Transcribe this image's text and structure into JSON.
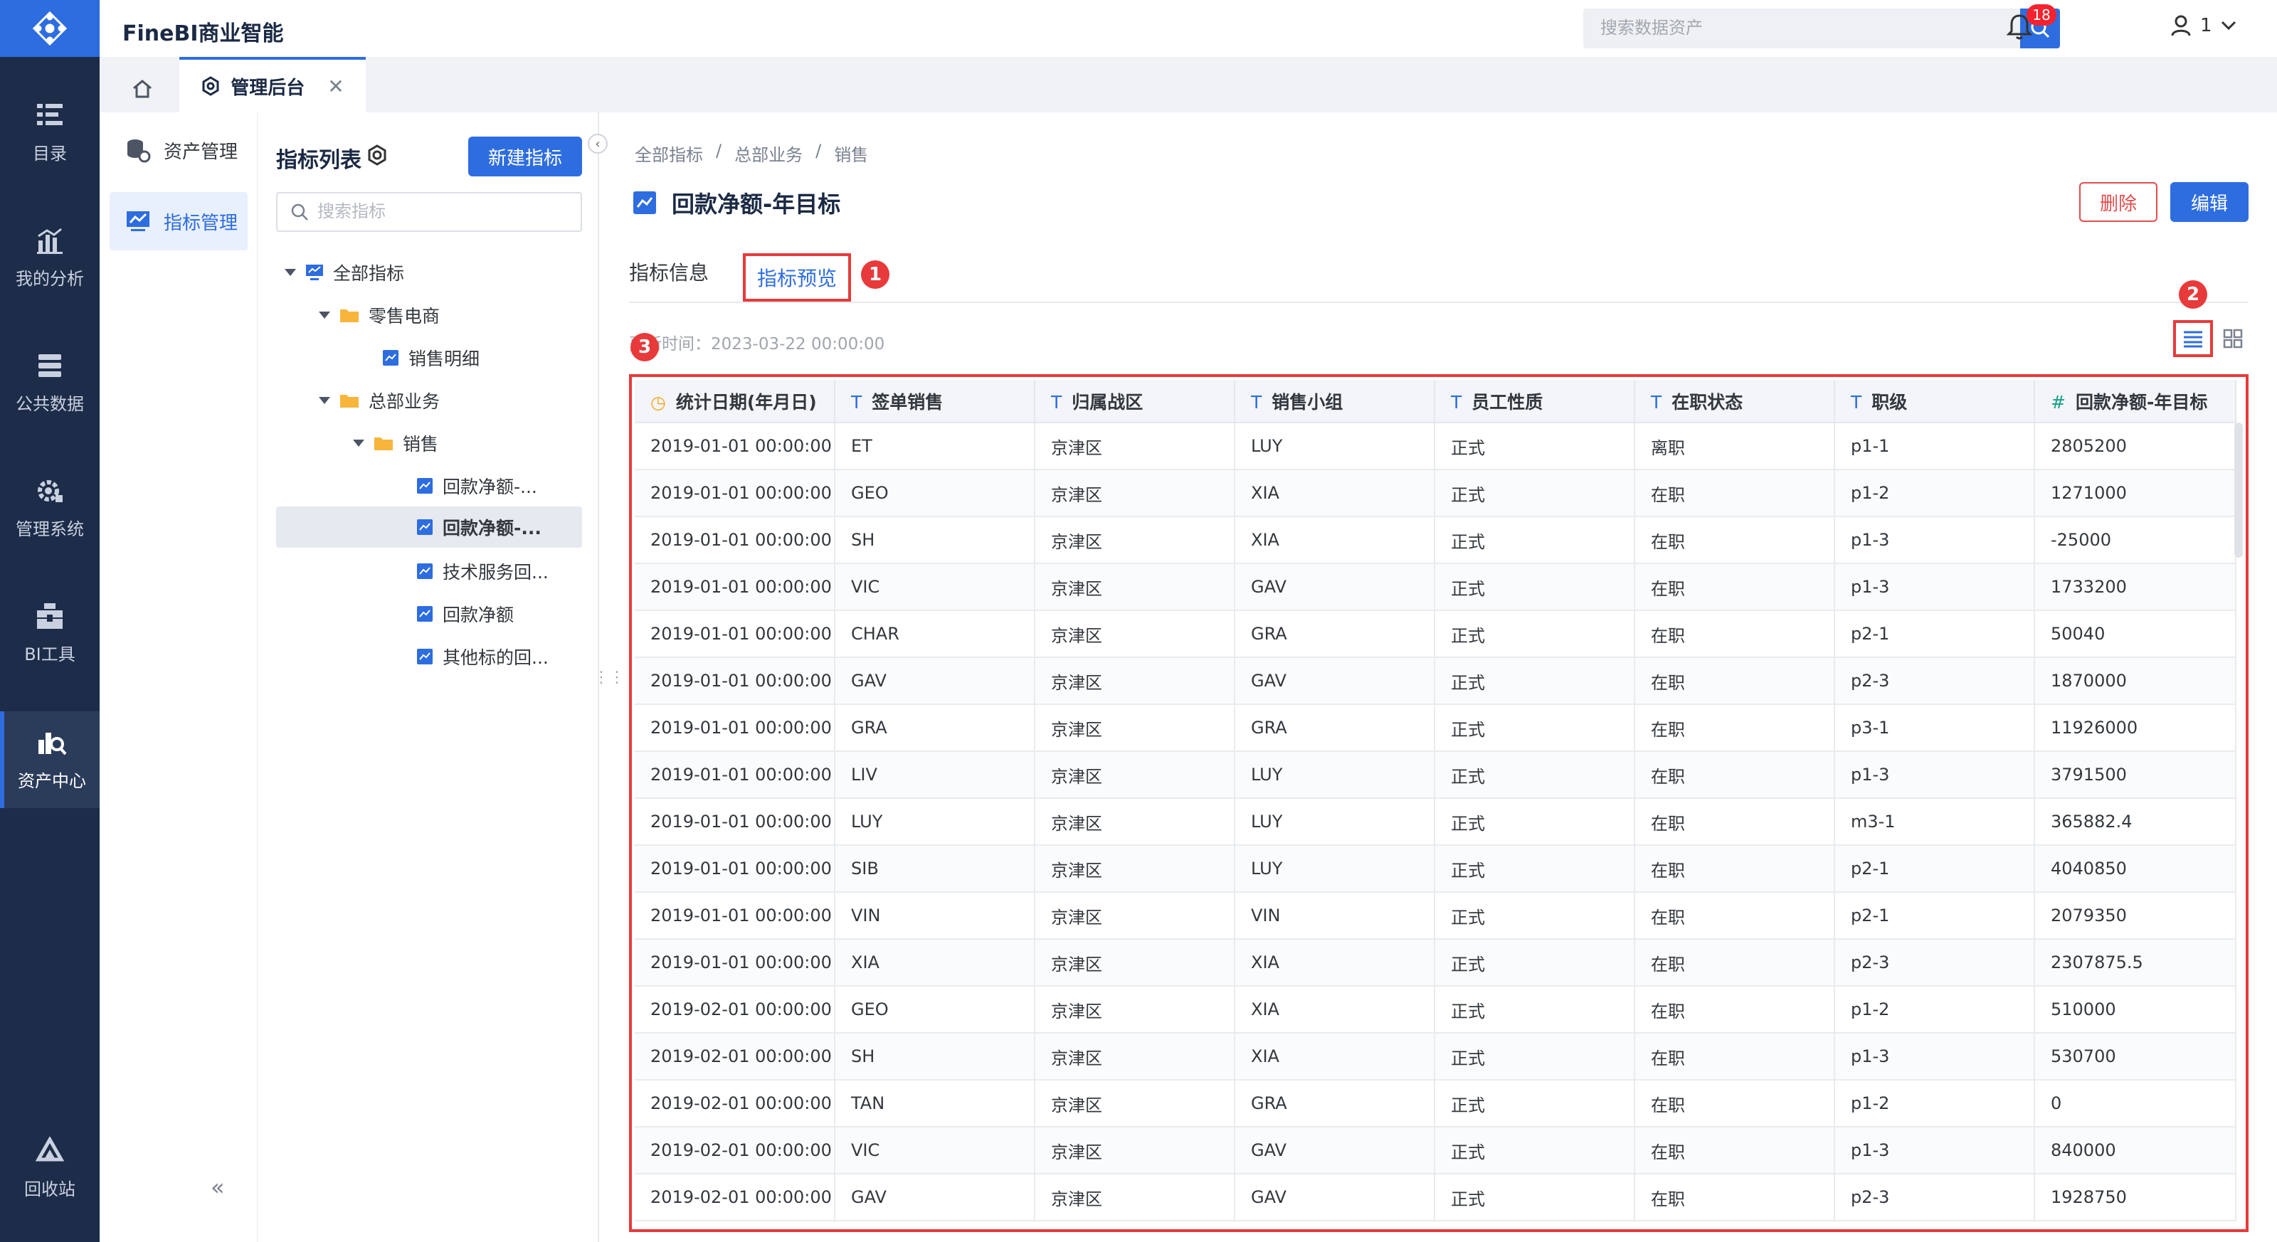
{
  "app": {
    "title": "FineBI商业智能"
  },
  "header": {
    "search_placeholder": "搜索数据资产",
    "notification_count": "18",
    "user_label": "1"
  },
  "nav": {
    "items": [
      {
        "label": "目录",
        "icon": "catalog-icon"
      },
      {
        "label": "我的分析",
        "icon": "analysis-icon"
      },
      {
        "label": "公共数据",
        "icon": "public-data-icon"
      },
      {
        "label": "管理系统",
        "icon": "management-icon"
      },
      {
        "label": "BI工具",
        "icon": "bi-tools-icon"
      },
      {
        "label": "资产中心",
        "icon": "asset-center-icon"
      },
      {
        "label": "回收站",
        "icon": "recycle-bin-icon"
      }
    ],
    "active": "资产中心"
  },
  "tabs": {
    "admin_label": "管理后台"
  },
  "sidebar": {
    "items": [
      {
        "label": "资产管理"
      },
      {
        "label": "指标管理"
      }
    ],
    "active": "指标管理"
  },
  "tree": {
    "title": "指标列表",
    "new_button": "新建指标",
    "search_placeholder": "搜索指标",
    "nodes": [
      {
        "label": "全部指标"
      },
      {
        "label": "零售电商"
      },
      {
        "label": "销售明细"
      },
      {
        "label": "总部业务"
      },
      {
        "label": "销售"
      },
      {
        "label": "回款净额-..."
      },
      {
        "label": "回款净额-..."
      },
      {
        "label": "技术服务回..."
      },
      {
        "label": "回款净额"
      },
      {
        "label": "其他标的回..."
      }
    ]
  },
  "main": {
    "breadcrumb": [
      "全部指标",
      "/",
      "总部业务",
      "/",
      "销售"
    ],
    "title": "回款净额-年目标",
    "delete_button": "删除",
    "edit_button": "编辑",
    "tab_info": "指标信息",
    "tab_preview": "指标预览",
    "update_label": "更新时间：2023-03-22 00:00:00",
    "markers": [
      "1",
      "2",
      "3"
    ]
  },
  "table": {
    "columns": [
      {
        "label": "统计日期(年月日)",
        "icon": "◷"
      },
      {
        "label": "签单销售",
        "icon": "T"
      },
      {
        "label": "归属战区",
        "icon": "T"
      },
      {
        "label": "销售小组",
        "icon": "T"
      },
      {
        "label": "员工性质",
        "icon": "T"
      },
      {
        "label": "在职状态",
        "icon": "T"
      },
      {
        "label": "职级",
        "icon": "T"
      },
      {
        "label": "回款净额-年目标",
        "icon": "#"
      }
    ],
    "rows": [
      [
        "2019-01-01 00:00:00",
        "ET",
        "京津区",
        "LUY",
        "正式",
        "离职",
        "p1-1",
        "2805200"
      ],
      [
        "2019-01-01 00:00:00",
        "GEO",
        "京津区",
        "XIA",
        "正式",
        "在职",
        "p1-2",
        "1271000"
      ],
      [
        "2019-01-01 00:00:00",
        "SH",
        "京津区",
        "XIA",
        "正式",
        "在职",
        "p1-3",
        "-25000"
      ],
      [
        "2019-01-01 00:00:00",
        "VIC",
        "京津区",
        "GAV",
        "正式",
        "在职",
        "p1-3",
        "1733200"
      ],
      [
        "2019-01-01 00:00:00",
        "CHAR",
        "京津区",
        "GRA",
        "正式",
        "在职",
        "p2-1",
        "50040"
      ],
      [
        "2019-01-01 00:00:00",
        "GAV",
        "京津区",
        "GAV",
        "正式",
        "在职",
        "p2-3",
        "1870000"
      ],
      [
        "2019-01-01 00:00:00",
        "GRA",
        "京津区",
        "GRA",
        "正式",
        "在职",
        "p3-1",
        "11926000"
      ],
      [
        "2019-01-01 00:00:00",
        "LIV",
        "京津区",
        "LUY",
        "正式",
        "在职",
        "p1-3",
        "3791500"
      ],
      [
        "2019-01-01 00:00:00",
        "LUY",
        "京津区",
        "LUY",
        "正式",
        "在职",
        "m3-1",
        "365882.4"
      ],
      [
        "2019-01-01 00:00:00",
        "SIB",
        "京津区",
        "LUY",
        "正式",
        "在职",
        "p2-1",
        "4040850"
      ],
      [
        "2019-01-01 00:00:00",
        "VIN",
        "京津区",
        "VIN",
        "正式",
        "在职",
        "p2-1",
        "2079350"
      ],
      [
        "2019-01-01 00:00:00",
        "XIA",
        "京津区",
        "XIA",
        "正式",
        "在职",
        "p2-3",
        "2307875.5"
      ],
      [
        "2019-02-01 00:00:00",
        "GEO",
        "京津区",
        "XIA",
        "正式",
        "在职",
        "p1-2",
        "510000"
      ],
      [
        "2019-02-01 00:00:00",
        "SH",
        "京津区",
        "XIA",
        "正式",
        "在职",
        "p1-3",
        "530700"
      ],
      [
        "2019-02-01 00:00:00",
        "TAN",
        "京津区",
        "GRA",
        "正式",
        "在职",
        "p1-2",
        "0"
      ],
      [
        "2019-02-01 00:00:00",
        "VIC",
        "京津区",
        "GAV",
        "正式",
        "在职",
        "p1-3",
        "840000"
      ],
      [
        "2019-02-01 00:00:00",
        "GAV",
        "京津区",
        "GAV",
        "正式",
        "在职",
        "p2-3",
        "1928750"
      ]
    ]
  },
  "colors": {
    "accent": "#2e6ddf",
    "nav_bg": "#1d2c48",
    "highlight": "#e83a3a"
  }
}
